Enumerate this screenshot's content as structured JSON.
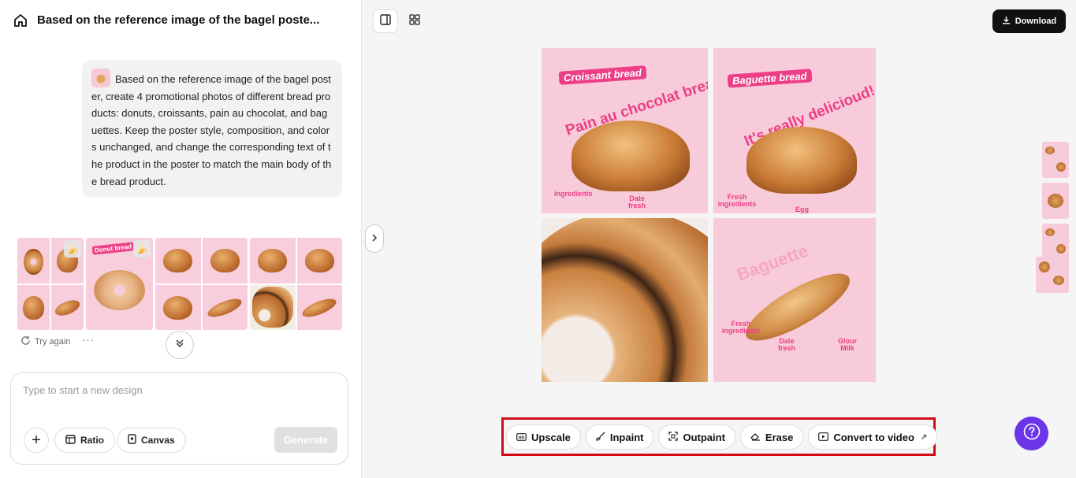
{
  "header": {
    "title": "Based on the reference image of the bagel poste...",
    "home_icon": "home-icon"
  },
  "chat": {
    "message": "Based on the reference image of the bagel poster, create 4 promotional photos of different bread products: donuts, croissants, pain au chocolat, and baguettes. Keep the poster style, composition, and colors unchanged, and change the corresponding text of the product in the poster to match the main body of the bread product.",
    "results": {
      "badge_icon": "banana-icon",
      "donut_label": "Donut bread"
    },
    "try_again": "Try again",
    "more": "···"
  },
  "composer": {
    "placeholder": "Type to start a new design",
    "ratio_label": "Ratio",
    "canvas_label": "Canvas",
    "generate_label": "Generate"
  },
  "canvas_view": {
    "download_label": "Download",
    "panel1": {
      "tag": "Croissant bread",
      "headline": "Pain au chocolat bread!",
      "annot_a": "ingredients",
      "annot_b": "Date fresh"
    },
    "panel2": {
      "tag": "Baguette bread",
      "headline": "It's really delicioud!",
      "annot_a": "Fresh ingredients",
      "annot_b": "Egg"
    },
    "panel4": {
      "headline": "Baguette",
      "annot_a": "Fresh ingredients",
      "annot_b": "Date fresh",
      "annot_c": "Glour Milk"
    }
  },
  "toolbar": {
    "upscale": "Upscale",
    "inpaint": "Inpaint",
    "outpaint": "Outpaint",
    "erase": "Erase",
    "convert_to_video": "Convert to video"
  },
  "colors": {
    "accent_pink": "#ec3f86",
    "help_purple": "#6b35e8",
    "highlight_red": "#d10a16"
  }
}
